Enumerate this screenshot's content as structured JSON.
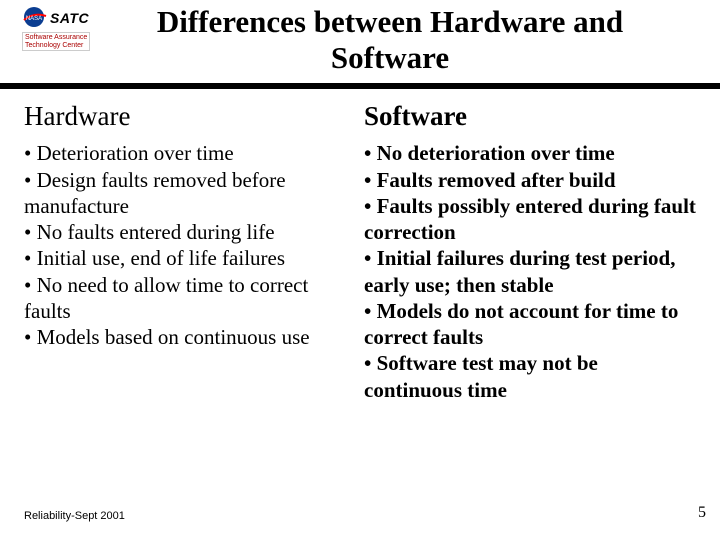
{
  "logo": {
    "brand": "SATC",
    "sub1": "Software Assurance",
    "sub2": "Technology Center"
  },
  "title": "Differences between Hardware and Software",
  "columns": {
    "hardware": {
      "heading": "Hardware",
      "text": "• Deterioration over time\n• Design faults removed before manufacture\n• No faults entered during life\n• Initial use, end of life failures\n• No need to allow time to correct faults\n• Models based on continuous use"
    },
    "software": {
      "heading": "Software",
      "text": "• No deterioration over time\n• Faults removed after build\n• Faults possibly entered during fault correction\n• Initial failures during test period, early use; then stable\n• Models do not account for time to correct faults\n• Software test may not be continuous time"
    }
  },
  "footer": {
    "left": "Reliability-Sept 2001",
    "right": "5"
  }
}
